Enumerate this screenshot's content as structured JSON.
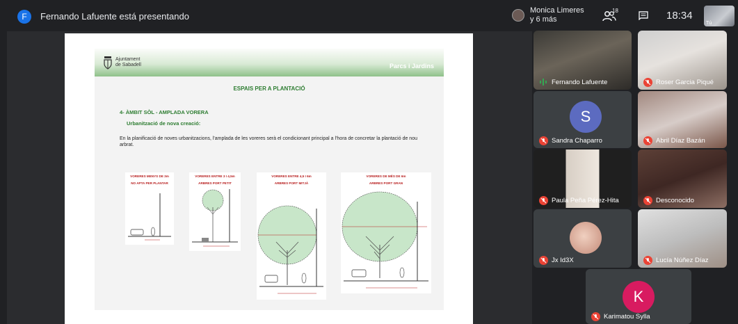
{
  "topbar": {
    "presenter_initial": "F",
    "presenting_text": "Fernando Lafuente está presentando",
    "notification_line1": "Monica Limeres",
    "notification_line2": "y 6 más",
    "people_count": "18",
    "time": "18:34",
    "self_label": "Tú"
  },
  "slide": {
    "logo_line1": "Ajuntament",
    "logo_line2": "de Sabadell",
    "brand": "Parcs i Jardins",
    "title": "ESPAIS PER A PLANTACIÓ",
    "section": "4- ÀMBIT SÒL - AMPLADA VORERA",
    "subsection": "Urbanització de nova creació:",
    "body": "En la planificació de noves urbanitzacions, l'amplada de les  voreres serà el condicionant principal a l'hora de concretar la plantació de nou arbrat.",
    "diagrams": [
      {
        "line1": "VORERES MENYS DE 3m",
        "line2": "NO APTA PER PLANTAR"
      },
      {
        "line1": "VORERES ENTRE 3 I 4,5m",
        "line2": "ARBRES PORT PETIT"
      },
      {
        "line1": "VORERES ENTRE 4,5 I 6m",
        "line2": "ARBRES PORT MITJÀ"
      },
      {
        "line1": "VORERES DE MÉS DE 6m",
        "line2": "ARBRES PORT GRAN"
      }
    ]
  },
  "participants": [
    {
      "name": "Fernando Lafuente",
      "muted": false
    },
    {
      "name": "Roser Garcia Piqué",
      "muted": true
    },
    {
      "name": "Sandra Chaparro",
      "muted": true,
      "initial": "S"
    },
    {
      "name": "Abril Díaz Bazán",
      "muted": true
    },
    {
      "name": "Paula Peña Pérez-Hita",
      "muted": true
    },
    {
      "name": "Desconocido",
      "muted": true
    },
    {
      "name": "Jx Id3X",
      "muted": true
    },
    {
      "name": "Lucía Núñez Díaz",
      "muted": true
    },
    {
      "name": "Karimatou Sylla",
      "muted": true,
      "initial": "K"
    }
  ],
  "colors": {
    "accent_blue": "#1a73e8",
    "muted_red": "#ea4335",
    "speaking_green": "#34a853",
    "sandra_avatar": "#5c6bc0",
    "karimatou_avatar": "#d81b60"
  }
}
